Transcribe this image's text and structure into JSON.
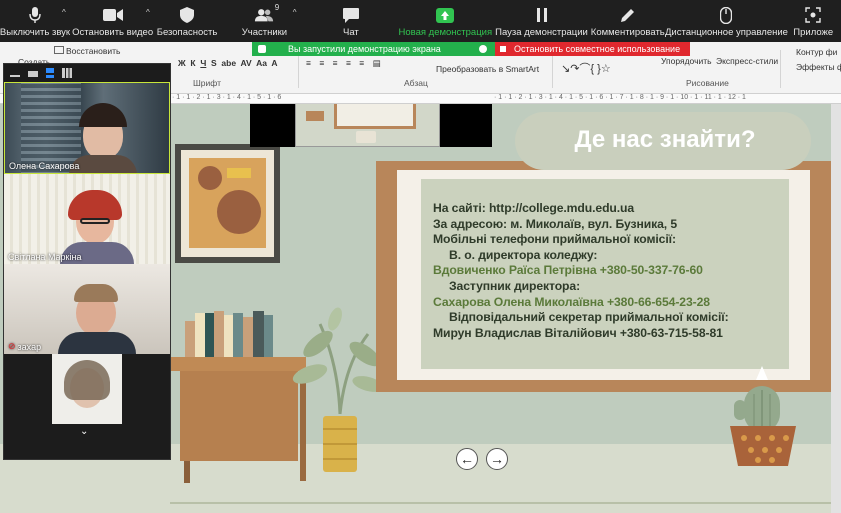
{
  "zoom_toolbar": {
    "items": [
      {
        "id": "mute",
        "label": "Выключить звук",
        "icon": "microphone-icon"
      },
      {
        "id": "video",
        "label": "Остановить видео",
        "icon": "video-camera-icon"
      },
      {
        "id": "security",
        "label": "Безопасность",
        "icon": "shield-icon"
      },
      {
        "id": "participants",
        "label": "Участники",
        "icon": "participants-icon",
        "count": "9"
      },
      {
        "id": "chat",
        "label": "Чат",
        "icon": "chat-bubble-icon"
      },
      {
        "id": "new_share",
        "label": "Новая демонстрация",
        "icon": "share-arrow-icon"
      },
      {
        "id": "pause_share",
        "label": "Пауза демонстрации",
        "icon": "pause-icon"
      },
      {
        "id": "annotate",
        "label": "Комментировать",
        "icon": "pencil-icon"
      },
      {
        "id": "remote",
        "label": "Дистанционное управление",
        "icon": "mouse-icon"
      },
      {
        "id": "apps",
        "label": "Приложе",
        "icon": "apps-icon"
      }
    ]
  },
  "share_banner": {
    "status": "Вы запустили демонстрацию экрана",
    "stop": "Остановить совместное использование"
  },
  "word_ribbon": {
    "create": "Создать",
    "restore": "Восстановить",
    "font_group": "Шрифт",
    "paragraph_group": "Абзац",
    "convert_smartart": "Преобразовать в SmartArt",
    "arrange": "Упорядочить",
    "quick_styles": "Экспресс-стили",
    "drawing_group": "Рисование",
    "shape_outline": "Контур фи",
    "shape_effects": "Эффекты ф"
  },
  "participants": [
    {
      "name": "Олена Сахарова",
      "muted": false
    },
    {
      "name": "Світлана Маркіна",
      "muted": false
    },
    {
      "name": "захар",
      "muted": true
    },
    {
      "name": "",
      "muted": false
    }
  ],
  "slide": {
    "title": "Де нас знайти?",
    "lines": [
      {
        "text": "На сайті: http://college.mdu.edu.ua",
        "tone": "dark",
        "indent": 0
      },
      {
        "text": "За адресою: м. Миколаїв, вул. Бузника, 5",
        "tone": "dark",
        "indent": 0
      },
      {
        "text": "Мобільні телефони приймальної комісії:",
        "tone": "dark",
        "indent": 0
      },
      {
        "text": "В. о. директора коледжу:",
        "tone": "dark",
        "indent": 16
      },
      {
        "text": "Вдовиченко Раїса Петрівна +380-50-337-76-60",
        "tone": "green",
        "indent": 0
      },
      {
        "text": "Заступник директора:",
        "tone": "dark",
        "indent": 16
      },
      {
        "text": "Сахарова Олена Миколаївна +380-66-654-23-28",
        "tone": "green",
        "indent": 0
      },
      {
        "text": "Відповідальний секретар приймальної комісії:",
        "tone": "dark",
        "indent": 16
      },
      {
        "text": "Мирун Владислав Віталійович +380-63-715-58-81",
        "tone": "dark",
        "indent": 0
      }
    ],
    "nav": {
      "prev": "←",
      "next": "→"
    }
  },
  "colors": {
    "toolbar_bg": "#1f1f1f",
    "share_green": "#23b04c",
    "stop_red": "#e0282e",
    "slide_bg": "#bfccbe",
    "frame_brown": "#b8865a",
    "title_bg": "#c9cfbd",
    "info_bg": "#cbd2be"
  }
}
